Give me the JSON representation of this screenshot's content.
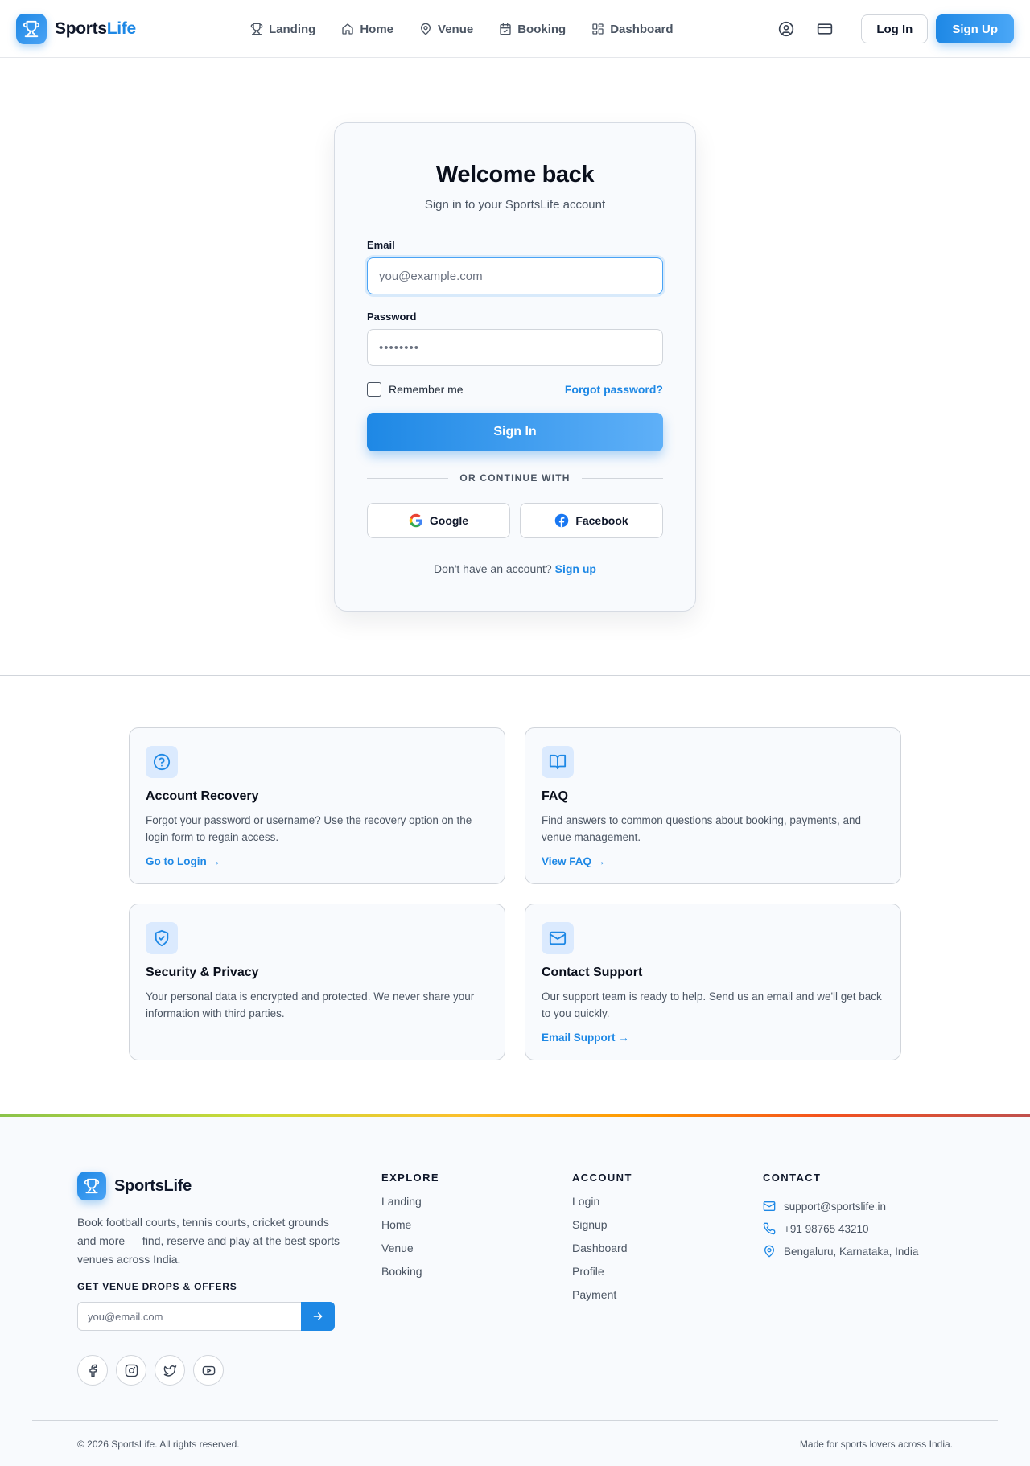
{
  "brand": {
    "name_main": "Sports",
    "name_accent": "Life",
    "footer_name": "SportsLife"
  },
  "nav": [
    {
      "label": "Landing",
      "icon": "trophy-icon"
    },
    {
      "label": "Home",
      "icon": "home-icon"
    },
    {
      "label": "Venue",
      "icon": "map-pin-icon"
    },
    {
      "label": "Booking",
      "icon": "calendar-icon"
    },
    {
      "label": "Dashboard",
      "icon": "dashboard-icon"
    }
  ],
  "header": {
    "login_label": "Log In",
    "signup_label": "Sign Up"
  },
  "login": {
    "title": "Welcome back",
    "subtitle": "Sign in to your SportsLife account",
    "email_label": "Email",
    "email_placeholder": "you@example.com",
    "password_label": "Password",
    "password_value": "••••••••",
    "remember_label": "Remember me",
    "forgot_label": "Forgot password?",
    "signin_label": "Sign In",
    "or_text": "OR CONTINUE WITH",
    "google_label": "Google",
    "facebook_label": "Facebook",
    "no_account_text": "Don't have an account?",
    "signup_link": "Sign up"
  },
  "help_cards": [
    {
      "icon": "help-circle-icon",
      "title": "Account Recovery",
      "text": "Forgot your password or username? Use the recovery option on the login form to regain access.",
      "link": "Go to Login →"
    },
    {
      "icon": "book-open-icon",
      "title": "FAQ",
      "text": "Find answers to common questions about booking, payments, and venue management.",
      "link": "View FAQ →"
    },
    {
      "icon": "shield-check-icon",
      "title": "Security & Privacy",
      "text": "Your personal data is encrypted and protected. We never share your information with third parties.",
      "link": ""
    },
    {
      "icon": "mail-icon",
      "title": "Contact Support",
      "text": "Our support team is ready to help. Send us an email and we'll get back to you quickly.",
      "link": "Email Support →"
    }
  ],
  "footer": {
    "description": "Book football courts, tennis courts, cricket grounds and more — find, reserve and play at the best sports venues across India.",
    "newsletter_label": "GET VENUE DROPS & OFFERS",
    "newsletter_placeholder": "you@email.com",
    "explore_title": "EXPLORE",
    "explore": [
      "Landing",
      "Home",
      "Venue",
      "Booking"
    ],
    "account_title": "ACCOUNT",
    "account": [
      "Login",
      "Signup",
      "Dashboard",
      "Profile",
      "Payment"
    ],
    "contact_title": "CONTACT",
    "contact": {
      "email": "support@sportslife.in",
      "phone": "+91 98765 43210",
      "address": "Bengaluru, Karnataka, India"
    },
    "socials": [
      "facebook-icon",
      "instagram-icon",
      "twitter-icon",
      "youtube-icon"
    ],
    "copyright": "© 2026 SportsLife. All rights reserved.",
    "made_for": "Made for sports lovers across India."
  },
  "colors": {
    "accent": "#1e88e5",
    "accent_light": "#4aa3f5",
    "card_bg": "#f8fafd",
    "icon_bg": "#dbeafe"
  }
}
